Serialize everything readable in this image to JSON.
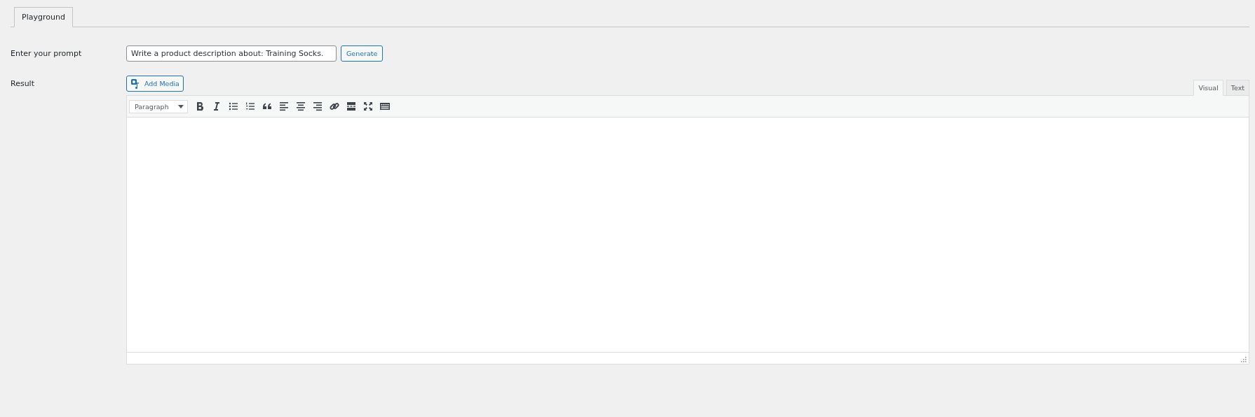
{
  "tabs": [
    {
      "label": "Playground",
      "selected": true
    }
  ],
  "prompt": {
    "label": "Enter your prompt",
    "value": "Write a product description about: Training Socks.",
    "button": "Generate"
  },
  "result": {
    "label": "Result",
    "add_media": "Add Media",
    "editor_tabs": [
      {
        "label": "Visual",
        "selected": true
      },
      {
        "label": "Text",
        "selected": false
      }
    ],
    "format": "Paragraph"
  }
}
